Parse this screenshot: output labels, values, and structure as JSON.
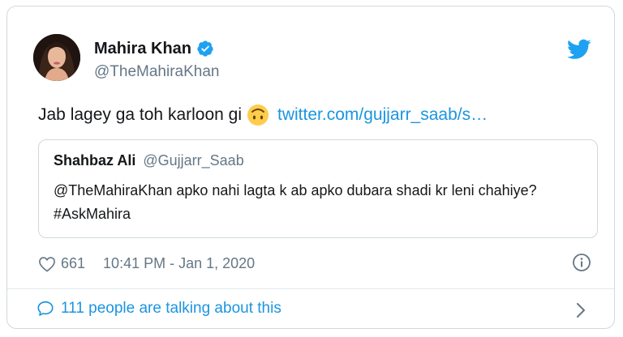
{
  "tweet": {
    "author_name": "Mahira Khan",
    "author_handle": "@TheMahiraKhan",
    "text": "Jab lagey ga toh karloon gi",
    "emoji": "upside-down-face-emoji",
    "link_text": "twitter.com/gujjarr_saab/s…",
    "likes": "661",
    "timestamp": "10:41 PM - Jan 1, 2020"
  },
  "quoted": {
    "name": "Shahbaz Ali",
    "handle": "@Gujjarr_Saab",
    "text": "@TheMahiraKhan apko nahi lagta k ab apko dubara shadi kr leni chahiye? #AskMahira"
  },
  "footer": {
    "label": "111 people are talking about this"
  },
  "colors": {
    "accent": "#1b95e0",
    "text": "#14171a",
    "secondary": "#657786",
    "border": "#cfd9de"
  },
  "icons": [
    "verified-badge-icon",
    "twitter-bird-icon",
    "heart-icon",
    "info-icon",
    "comment-bubble-icon",
    "chevron-right-icon"
  ]
}
